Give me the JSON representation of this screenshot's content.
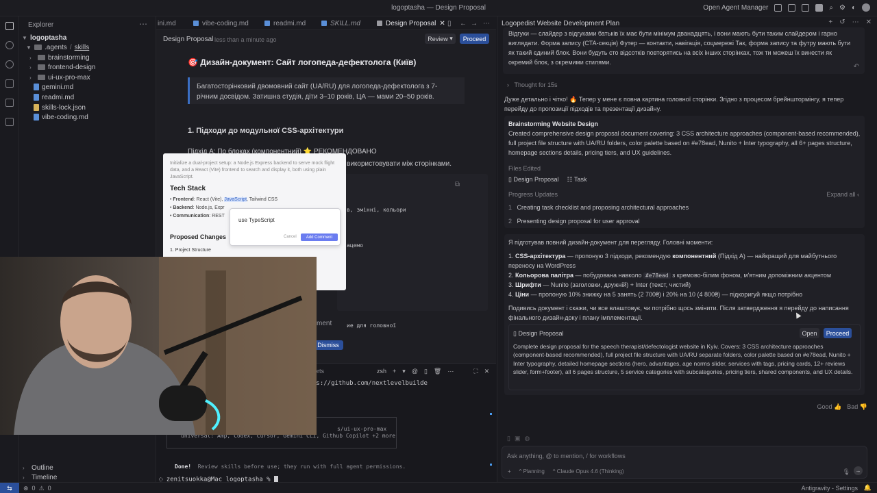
{
  "window": {
    "title": "logoptasha — Design Proposal",
    "agent_manager": "Open Agent Manager"
  },
  "sidebar": {
    "header": "Explorer",
    "root": "logoptasha",
    "agents_folder": ".agents",
    "skills_folder": "skills",
    "items": [
      {
        "label": "brainstorming",
        "type": "folder"
      },
      {
        "label": "frontend-design",
        "type": "folder"
      },
      {
        "label": "ui-ux-pro-max",
        "type": "folder"
      },
      {
        "label": "gemini.md",
        "type": "file"
      },
      {
        "label": "readmi.md",
        "type": "file"
      },
      {
        "label": "skills-lock.json",
        "type": "json"
      },
      {
        "label": "vibe-coding.md",
        "type": "file"
      }
    ],
    "outline": "Outline",
    "timeline": "Timeline"
  },
  "tabs": [
    {
      "label": "ini.md"
    },
    {
      "label": "vibe-coding.md"
    },
    {
      "label": "readmi.md"
    },
    {
      "label": "SKILL.md"
    },
    {
      "label": "Design Proposal",
      "active": true
    }
  ],
  "editor": {
    "doc_title": "Design Proposal",
    "timestamp": "less than a minute ago",
    "review_label": "Review",
    "proceed_label": "Proceed",
    "heading": "🎯 Дизайн-документ: Сайт логопеда-дефектолога (Київ)",
    "callout": "Багатосторінковий двомовний сайт (UA/RU) для логопеда-дефектолога з 7-річним досвідом. Затишна студія, діти 3–10 років, ЦА — мами 20–50 років.",
    "section1": "1. Підходи до модульної CSS-архітектури",
    "approach_a": "Підхід A: По блоках (компонентний) ⭐ РЕКОМЕНДОВАНО",
    "reuse_frag": "використовувати між сторінками.",
    "code_frag1": "в, змінні, кольори",
    "code_frag2": "ацемо",
    "ment_frag": "ment",
    "code_frag3": "ие для головної",
    "dismiss": "Dismiss"
  },
  "popup": {
    "intro": "Initialize a dual-project setup: a Node.js Express backend to serve mock flight data, and a React (Vite) frontend to search and display it, both using plain JavaScript.",
    "tech_stack": "Tech Stack",
    "frontend_label": "Frontend",
    "frontend_value": "React (Vite),",
    "frontend_highlight": "JavaScript",
    "frontend_rest": ", Tailwind CSS",
    "backend_label": "Backend",
    "backend_value": "Node.js, Expr",
    "comm_label": "Communication",
    "comm_value": "REST",
    "comment_text": "use TypeScript",
    "cancel": "Cancel",
    "add_comment": "Add Comment",
    "proposed_changes": "Proposed Changes",
    "project_structure": "1. Project Structure"
  },
  "terminal": {
    "title_frag": "orts",
    "shell": "zsh",
    "url_line": "os://github.com/nextlevelbuilde",
    "box_line1": "s/ui-ux-pro-max",
    "box_line2": "universal: Amp, Codex, Cursor, Gemini CLI, Github Copilot +2 more",
    "done": "Done!",
    "done_msg": "Review skills before use; they run with full agent permissions.",
    "prompt": "zenitsuokka@Mac logoptasha % "
  },
  "agent": {
    "title": "Logopedist Website Development Plan",
    "user_msg": "Відгуки — слайдер з відгуками батьків їх має бути мінімум дванадцять, і вони мають бути таким слайдером і гарно виглядати. Форма запису (CTA-секція)  Футер — контакти, навігація, соцмережі Так, форма запису та футру мають бути як такий єдиний блок. Вони будуть сто відсотків повторятись на всіх інших сторінках, тож ти можеш їх винести як окремий блок, з окремими стилями.",
    "thought": "Thought for 15s",
    "reply1": "Дуже детально і чітко! 🔥 Тепер у мене є повна картина головної сторінки. Згідно з процесом брейнштормінгу, я тепер перейду до пропозиції підходів та презентації дизайну.",
    "task_title": "Brainstorming Website Design",
    "task_desc": "Created comprehensive design proposal document covering: 3 CSS architecture approaches (component-based recommended), full project file structure with UA/RU folders, color palette based on #e78ead, Nunito + Inter typography, all 6+ pages structure, homepage sections details, pricing tiers, and UX guidelines.",
    "files_edited": "Files Edited",
    "file1": "Design Proposal",
    "file2": "Task",
    "progress": "Progress Updates",
    "expand_all": "Expand all",
    "steps": [
      {
        "n": "1",
        "text": "Creating task checklist and proposing architectural approaches"
      },
      {
        "n": "2",
        "text": "Presenting design proposal for user approval"
      }
    ],
    "summary_intro": "Я підготував повний дизайн-документ для перегляду. Головні моменти:",
    "points": [
      {
        "n": "1.",
        "bold": "CSS-архітектура",
        "text": " — пропоную 3 підходи, рекомендую ",
        "bold2": "компонентний",
        "text2": " (Підхід A) — найкращий для майбутнього переносу на WordPress"
      },
      {
        "n": "2.",
        "bold": "Кольорова палітра",
        "text": " — побудована навколо ",
        "code": "#e78ead",
        "text2": " з кремово-білим фоном, м'ятним допоміжним акцентом"
      },
      {
        "n": "3.",
        "bold": "Шрифти",
        "text": " — Nunito (заголовки, дружній) + Inter (текст, чистий)"
      },
      {
        "n": "4.",
        "bold": "Ціни",
        "text": " — пропоную 10% знижку на 5 занять (2 700₴) і 20% на 10 (4 800₴) — підкоригуй якщо потрібно"
      }
    ],
    "closing": "Подивись документ і скажи, чи все влаштовує, чи потрібно щось змінити. Після затвердження я перейду до написання фінального дизайн-доку і плану імплементації.",
    "doc_card_title": "Design Proposal",
    "open": "Open",
    "proceed": "Proceed",
    "doc_card_desc": "Complete design proposal for the speech therapist/defectologist website in Kyiv. Covers: 3 CSS architecture approaches (component-based recommended), full project file structure with UA/RU separate folders, color palette based on #e78ead, Nunito + Inter typography, detailed homepage sections (hero, advantages, age norms slider, services with tags, pricing cards, 12+ reviews slider, form+footer), all 6 pages structure, 5 service categories with subcategories, pricing tiers, shared components, and UX details.",
    "good": "Good",
    "bad": "Bad",
    "input_placeholder": "Ask anything, @ to mention, / for workflows",
    "mode": "Planning",
    "model": "Claude Opus 4.6 (Thinking)"
  },
  "status": {
    "errors": "0",
    "warnings": "0",
    "brand": "Antigravity - Settings"
  },
  "colors": {
    "accent": "#2b4f9a",
    "callout_border": "#3b6fc4",
    "cursor": "#4a9cf0"
  }
}
